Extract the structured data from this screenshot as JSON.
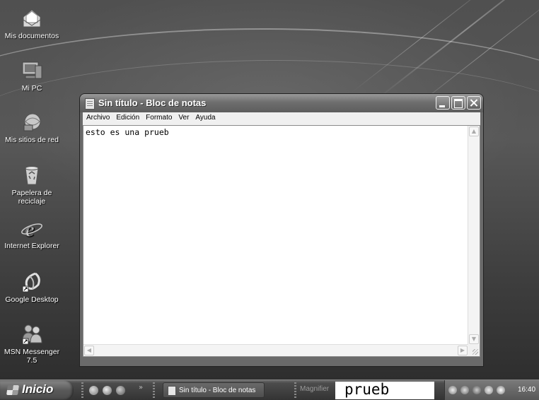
{
  "desktop": {
    "icons": [
      {
        "label": "Mis documentos",
        "icon": "my-documents-icon"
      },
      {
        "label": "Mi PC",
        "icon": "my-computer-icon"
      },
      {
        "label": "Mis sitios de red",
        "icon": "network-places-icon"
      },
      {
        "label": "Papelera de reciclaje",
        "icon": "recycle-bin-icon"
      },
      {
        "label": "Internet Explorer",
        "icon": "internet-explorer-icon"
      },
      {
        "label": "Google Desktop",
        "icon": "google-desktop-icon"
      },
      {
        "label": "MSN Messenger 7.5",
        "icon": "msn-messenger-icon"
      }
    ]
  },
  "window": {
    "title": "Sin título - Bloc de notas",
    "menu": [
      "Archivo",
      "Edición",
      "Formato",
      "Ver",
      "Ayuda"
    ],
    "content": "esto es una prueb"
  },
  "taskbar": {
    "start_label": "Inicio",
    "task_label": "Sin título - Bloc de notas",
    "magnifier_label": "Magnifier",
    "magnifier_text": "prueb",
    "clock": "16:40"
  },
  "theme": {
    "desktop_color": "#4e4e4e",
    "title_color": "#6e6e6e",
    "taskbar_color": "#3f3f3f"
  }
}
